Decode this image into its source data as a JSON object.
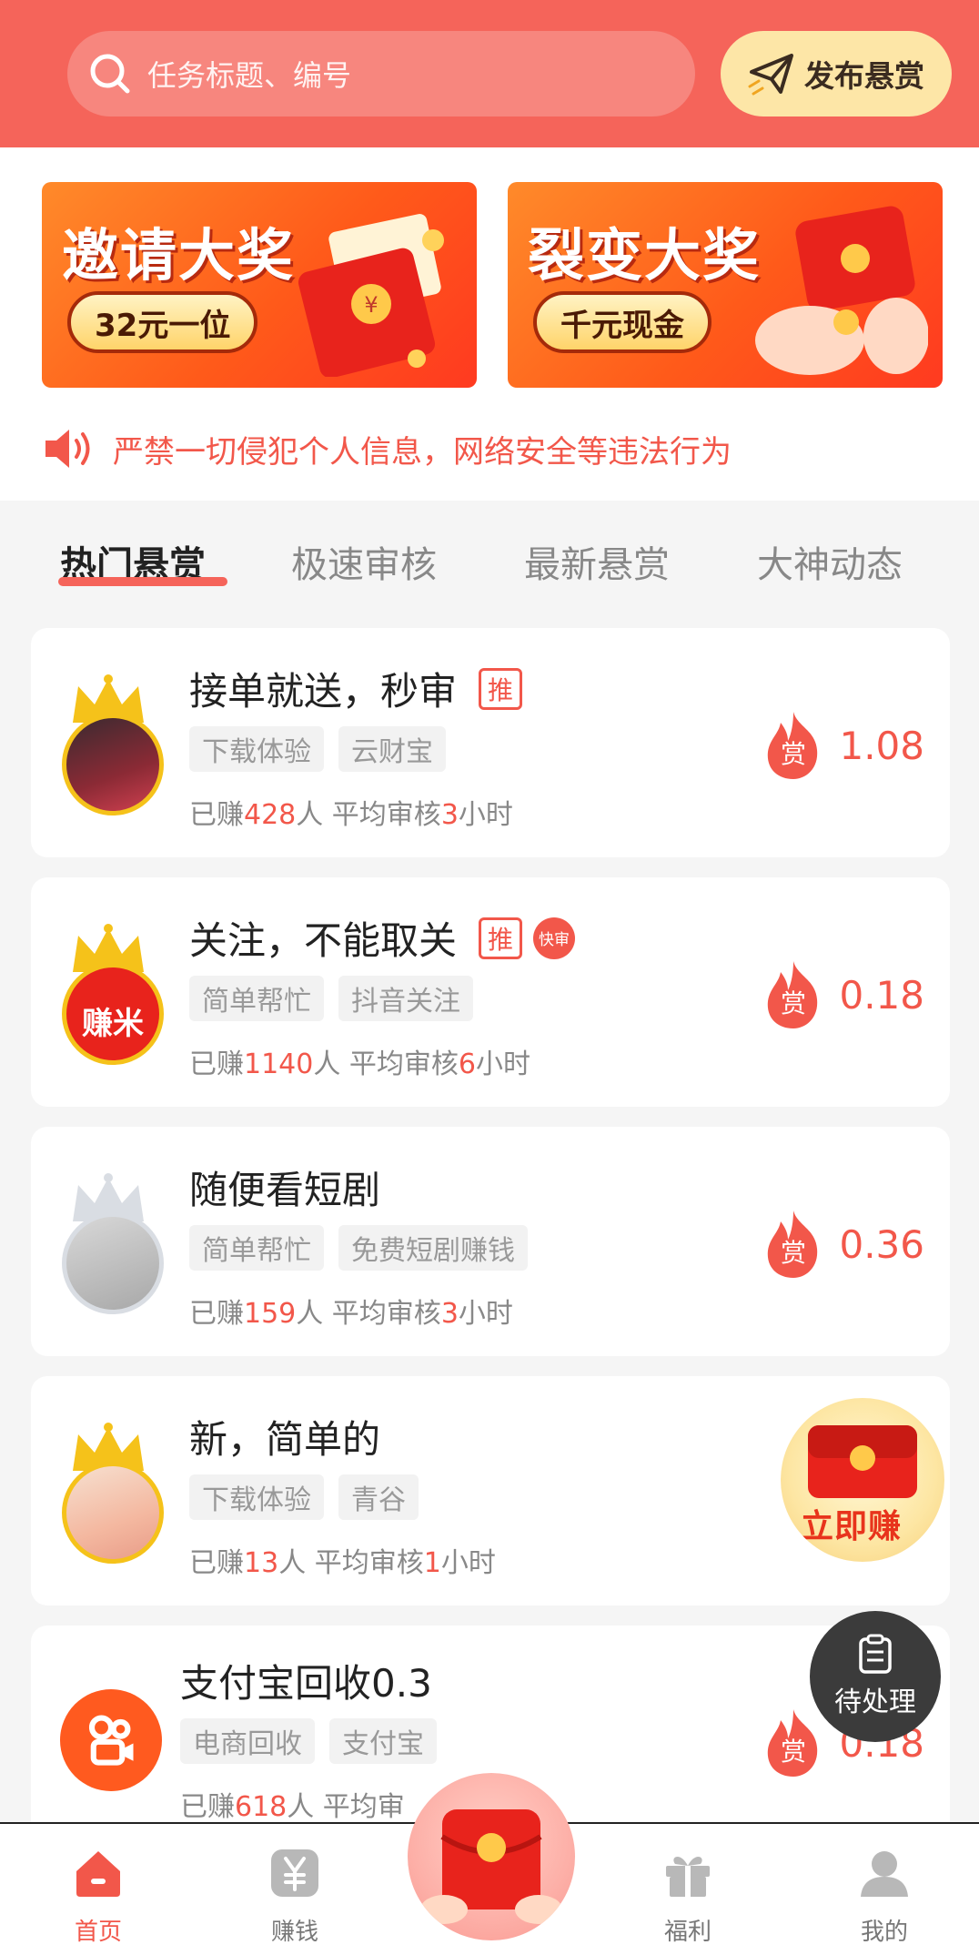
{
  "colors": {
    "header": "#f5645a",
    "accent": "#f2574a",
    "publish_bg": "#fde6a7"
  },
  "search": {
    "placeholder": "任务标题、编号",
    "icon": "search-icon"
  },
  "publish": {
    "label": "发布悬赏",
    "icon": "paper-plane-icon"
  },
  "banners": [
    {
      "title": "邀请大奖",
      "pill": "32元一位"
    },
    {
      "title": "裂变大奖",
      "pill": "千元现金"
    }
  ],
  "notice": {
    "text": "严禁一切侵犯个人信息，网络安全等违法行为",
    "icon": "speaker-icon"
  },
  "tabs": [
    {
      "label": "热门悬赏",
      "active": true
    },
    {
      "label": "极速审核"
    },
    {
      "label": "最新悬赏"
    },
    {
      "label": "大神动态"
    }
  ],
  "tasks": [
    {
      "title": "接单就送，秒审",
      "badge": "推",
      "tags": [
        "下载体验",
        "云财宝"
      ],
      "stats_prefix": "已赚",
      "earned": "428",
      "stats_mid": "人  平均审核",
      "hours": "3",
      "stats_suffix": "小时",
      "reward_icon_text": "赏",
      "reward": "1.08"
    },
    {
      "title": "关注，不能取关",
      "badge": "推",
      "fast_badge": "快审",
      "avatar_text": "赚米",
      "tags": [
        "简单帮忙",
        "抖音关注"
      ],
      "stats_prefix": "已赚",
      "earned": "1140",
      "stats_mid": "人  平均审核",
      "hours": "6",
      "stats_suffix": "小时",
      "reward_icon_text": "赏",
      "reward": "0.18"
    },
    {
      "title": "随便看短剧",
      "tags": [
        "简单帮忙",
        "免费短剧赚钱"
      ],
      "stats_prefix": "已赚",
      "earned": "159",
      "stats_mid": "人  平均审核",
      "hours": "3",
      "stats_suffix": "小时",
      "reward_icon_text": "赏",
      "reward": "0.36"
    },
    {
      "title": "新，简单的",
      "tags": [
        "下载体验",
        "青谷"
      ],
      "stats_prefix": "已赚",
      "earned": "13",
      "stats_mid": "人  平均审核",
      "hours": "1",
      "stats_suffix": "小时"
    },
    {
      "title": "支付宝回收0.3",
      "tags": [
        "电商回收",
        "支付宝"
      ],
      "stats_prefix": "已赚",
      "earned": "618",
      "stats_mid": "人  平均审",
      "reward_icon_text": "赏",
      "reward": "0.18"
    }
  ],
  "float_red_packet": {
    "label": "立即赚"
  },
  "float_pending": {
    "label": "待处理",
    "icon": "clipboard-icon"
  },
  "nav": [
    {
      "label": "首页",
      "icon": "home-icon",
      "active": true
    },
    {
      "label": "赚钱",
      "icon": "yen-icon"
    },
    {
      "label": "",
      "icon": "red-packet-icon"
    },
    {
      "label": "福利",
      "icon": "gift-icon"
    },
    {
      "label": "我的",
      "icon": "user-icon"
    }
  ]
}
